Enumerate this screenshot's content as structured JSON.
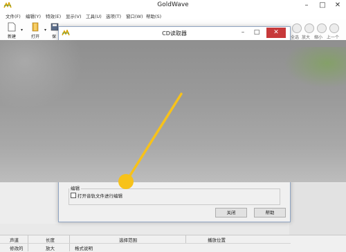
{
  "window": {
    "title": "GoldWave"
  },
  "menu": [
    "文件(F)",
    "编辑(Y)",
    "特效(E)",
    "显示(V)",
    "工具(U)",
    "选项(T)",
    "窗口(W)",
    "帮助(S)"
  ],
  "toolbar": {
    "new_label": "新建",
    "open_label": "打开",
    "save_label": "保",
    "right_labels": [
      "全选",
      "放大",
      "缩小",
      "上一个"
    ]
  },
  "dialog": {
    "title": "CD读取器",
    "group_label": "编辑",
    "checkbox_label": "打开音轨文件进行编辑",
    "close_button": "关闭",
    "help_button": "帮助"
  },
  "statusbar": {
    "row1": [
      "声道",
      "长度",
      "选择范围",
      "播放位置"
    ],
    "row2": [
      "修改的",
      "放大",
      "格式说明"
    ]
  },
  "colors": {
    "close_red": "#c7393a",
    "annotation_yellow": "#f7c21a"
  }
}
